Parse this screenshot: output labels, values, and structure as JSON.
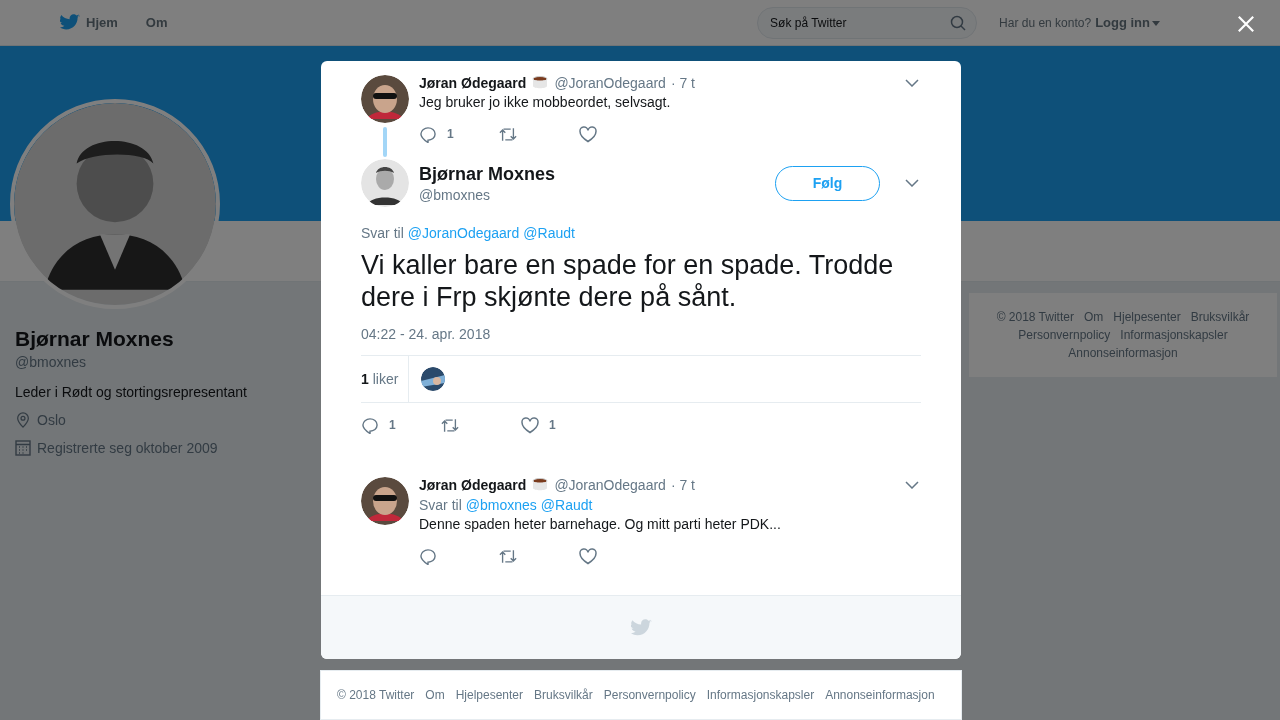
{
  "nav": {
    "home": "Hjem",
    "about": "Om",
    "search": {
      "placeholder": "Søk på Twitter"
    },
    "account_prompt": "Har du en konto?",
    "login": "Logg inn"
  },
  "profile": {
    "name": "Bjørnar Moxnes",
    "handle": "@bmoxnes",
    "bio": "Leder i Rødt og stortingsrepresentant",
    "location": "Oslo",
    "joined": "Registrerte seg oktober 2009"
  },
  "side_footer": [
    "© 2018 Twitter",
    "Om",
    "Hjelpesenter",
    "Bruksvilkår",
    "Personvernpolicy",
    "Informasjonskapsler",
    "Annonseinformasjon"
  ],
  "modal": {
    "parent_tweet": {
      "name": "Jøran Ødegaard",
      "handle": "@JoranOdegaard",
      "time": "· 7 t",
      "text": "Jeg bruker jo ikke mobbeordet, selvsagt.",
      "reply_count": "1"
    },
    "main_tweet": {
      "name": "Bjørnar Moxnes",
      "handle": "@bmoxnes",
      "follow": "Følg",
      "reply_to": "Svar til",
      "mentions": [
        "@JoranOdegaard",
        "@Raudt"
      ],
      "text": "Vi kaller bare en spade for en spade. Trodde dere i Frp skjønte dere på sånt.",
      "timestamp": "04:22 - 24. apr. 2018",
      "likes_count": "1",
      "likes_label": "liker",
      "reply_count": "1",
      "like_count": "1"
    },
    "reply_tweet": {
      "name": "Jøran Ødegaard",
      "handle": "@JoranOdegaard",
      "time": "· 7 t",
      "reply_to": "Svar til",
      "mentions": [
        "@bmoxnes",
        "@Raudt"
      ],
      "text": "Denne spaden heter barnehage. Og mitt parti heter PDK..."
    }
  },
  "footer": [
    "© 2018 Twitter",
    "Om",
    "Hjelpesenter",
    "Bruksvilkår",
    "Personvernpolicy",
    "Informasjonskapsler",
    "Annonseinformasjon"
  ]
}
